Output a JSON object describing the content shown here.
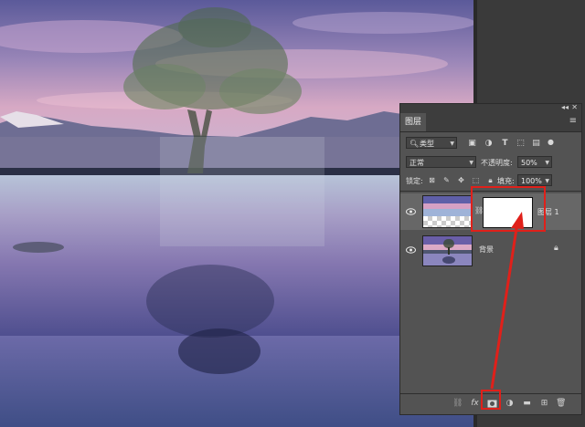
{
  "panel": {
    "title": "图层",
    "collapse_icon": "double-chevron-icon",
    "close_icon": "close-icon",
    "menu_icon": "panel-menu-icon",
    "filter": {
      "kind_label": "类型",
      "icons": [
        "image-filter-icon",
        "adjustment-filter-icon",
        "text-filter-icon",
        "shape-filter-icon",
        "smart-object-filter-icon",
        "toggle-filter-icon"
      ]
    },
    "blend_mode": "正常",
    "opacity_label": "不透明度:",
    "opacity_value": "50%",
    "lock_label": "锁定:",
    "fill_label": "填充:",
    "fill_value": "100%",
    "layers": [
      {
        "name": "图层 1",
        "selected": true,
        "has_mask": true
      },
      {
        "name": "背景",
        "selected": false,
        "locked": true
      }
    ],
    "bottom_icons": [
      "link-layers-icon",
      "fx-icon",
      "add-mask-icon",
      "adjustment-layer-icon",
      "new-group-icon",
      "new-layer-icon",
      "delete-layer-icon"
    ],
    "bottom_fx_label": "fx"
  },
  "annotation": {
    "color": "#e0201a"
  }
}
